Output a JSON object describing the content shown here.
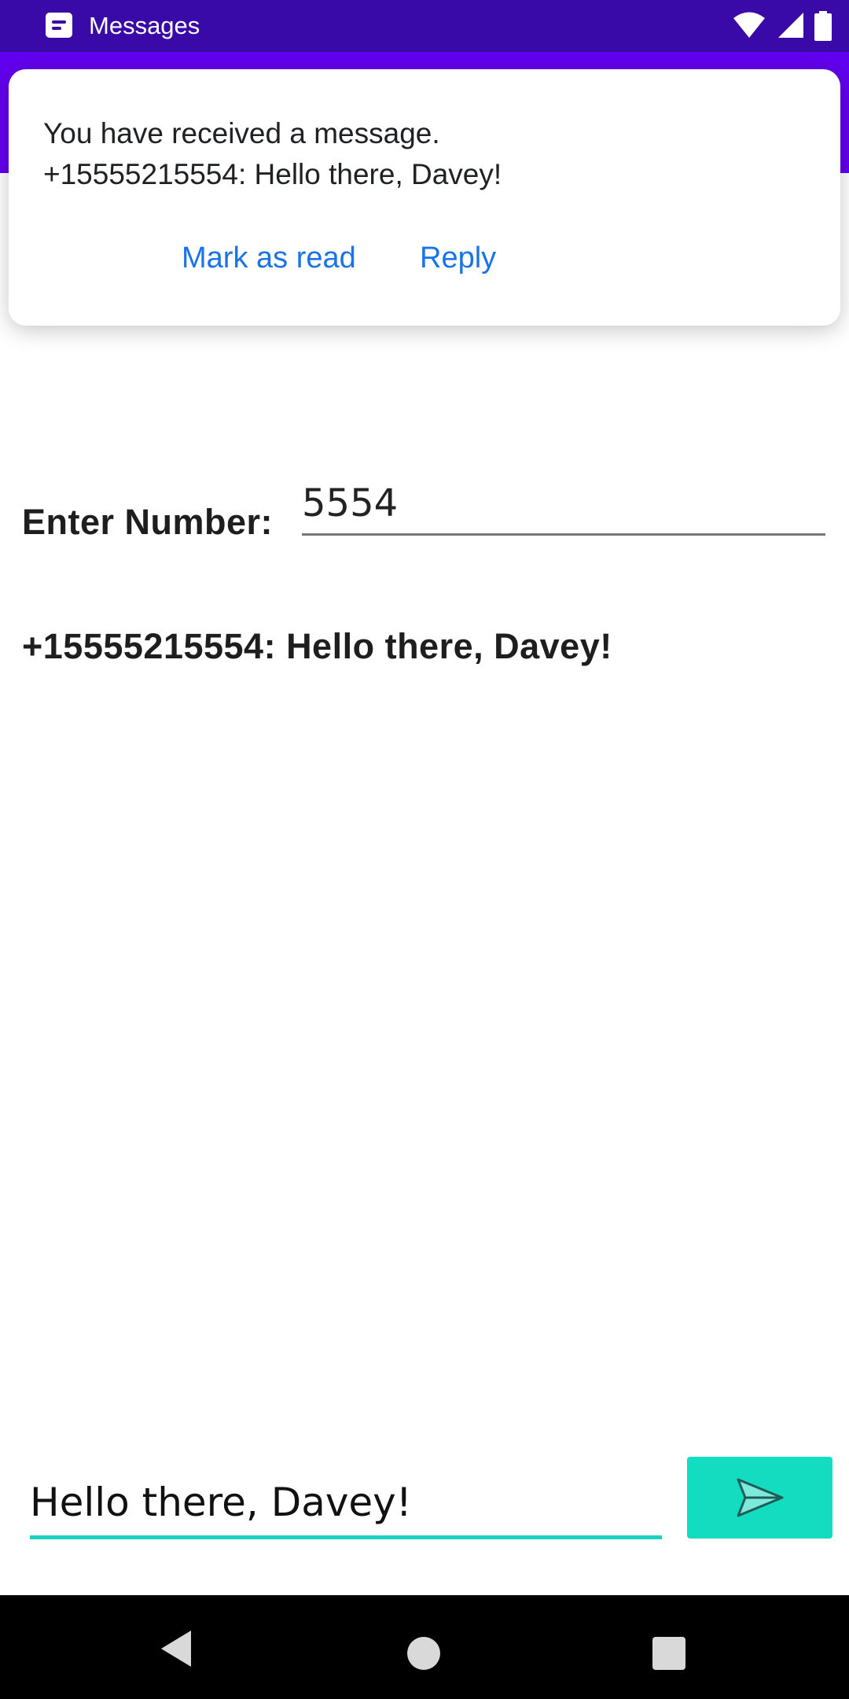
{
  "status_bar": {
    "app_name": "Messages",
    "icons": [
      "messages-app-icon",
      "wifi-icon",
      "signal-icon",
      "battery-icon"
    ]
  },
  "notification": {
    "title": "You have received a message.",
    "body": "+15555215554: Hello there, Davey!",
    "actions": [
      "Mark as read",
      "Reply"
    ]
  },
  "form": {
    "number_label": "Enter Number:",
    "number_value": "5554"
  },
  "received": {
    "message": "+15555215554: Hello there, Davey!"
  },
  "compose": {
    "value": "Hello there, Davey!",
    "send_icon": "send-icon"
  },
  "navigation": {
    "icons": [
      "back-icon",
      "home-icon",
      "recents-icon"
    ]
  },
  "colors": {
    "status_bar": "#3a0aa8",
    "app_bar": "#6200ee",
    "accent": "#13dcc1",
    "link": "#1a73e8"
  }
}
